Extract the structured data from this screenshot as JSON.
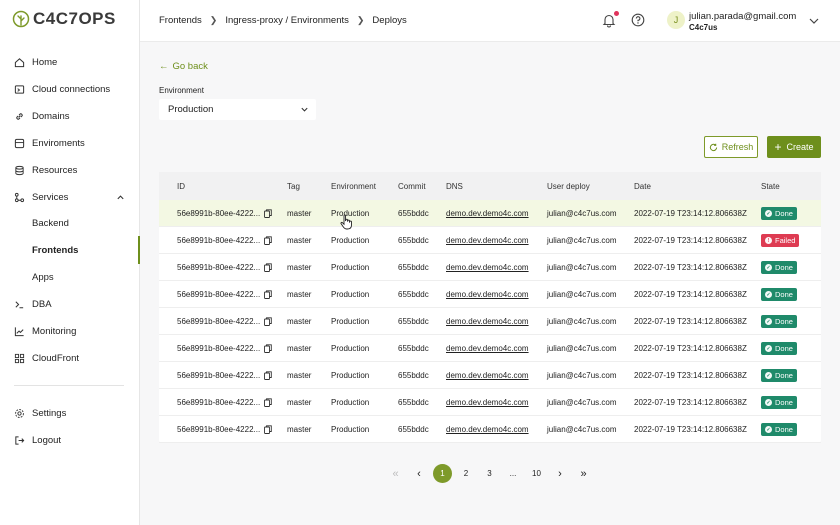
{
  "brand": {
    "logo_text": "C4C7OPS"
  },
  "sidebar": {
    "items": [
      {
        "label": "Home",
        "icon": "home-icon"
      },
      {
        "label": "Cloud connections",
        "icon": "cloud-connections-icon"
      },
      {
        "label": "Domains",
        "icon": "link-icon"
      },
      {
        "label": "Enviroments",
        "icon": "environments-icon"
      },
      {
        "label": "Resources",
        "icon": "database-icon"
      },
      {
        "label": "Services",
        "icon": "services-icon"
      },
      {
        "label": "Backend"
      },
      {
        "label": "Frontends"
      },
      {
        "label": "Apps"
      },
      {
        "label": "DBA",
        "icon": "terminal-icon"
      },
      {
        "label": "Monitoring",
        "icon": "chart-icon"
      },
      {
        "label": "CloudFront",
        "icon": "grid-icon"
      },
      {
        "label": "Settings",
        "icon": "gear-icon"
      },
      {
        "label": "Logout",
        "icon": "logout-icon"
      }
    ]
  },
  "breadcrumb": [
    "Frontends",
    "Ingress-proxy / Environments",
    "Deploys"
  ],
  "user": {
    "initial": "J",
    "email": "julian.parada@gmail.com",
    "org": "C4c7us"
  },
  "back_label": "Go back",
  "environment": {
    "label": "Environment",
    "value": "Production"
  },
  "buttons": {
    "refresh": "Refresh",
    "create": "Create"
  },
  "table": {
    "headers": [
      "ID",
      "Tag",
      "Environment",
      "Commit",
      "DNS",
      "User deploy",
      "Date",
      "State"
    ],
    "rows": [
      {
        "id": "56e8991b-80ee-4222...",
        "tag": "master",
        "env": "Production",
        "commit": "655bddc",
        "dns": "demo.dev.demo4c.com",
        "user": "julian@c4c7us.com",
        "date": "2022-07-19 T23:14:12.806638Z",
        "state": "Done",
        "status": "done"
      },
      {
        "id": "56e8991b-80ee-4222...",
        "tag": "master",
        "env": "Production",
        "commit": "655bddc",
        "dns": "demo.dev.demo4c.com",
        "user": "julian@c4c7us.com",
        "date": "2022-07-19 T23:14:12.806638Z",
        "state": "Failed",
        "status": "failed"
      },
      {
        "id": "56e8991b-80ee-4222...",
        "tag": "master",
        "env": "Production",
        "commit": "655bddc",
        "dns": "demo.dev.demo4c.com",
        "user": "julian@c4c7us.com",
        "date": "2022-07-19 T23:14:12.806638Z",
        "state": "Done",
        "status": "done"
      },
      {
        "id": "56e8991b-80ee-4222...",
        "tag": "master",
        "env": "Production",
        "commit": "655bddc",
        "dns": "demo.dev.demo4c.com",
        "user": "julian@c4c7us.com",
        "date": "2022-07-19 T23:14:12.806638Z",
        "state": "Done",
        "status": "done"
      },
      {
        "id": "56e8991b-80ee-4222...",
        "tag": "master",
        "env": "Production",
        "commit": "655bddc",
        "dns": "demo.dev.demo4c.com",
        "user": "julian@c4c7us.com",
        "date": "2022-07-19 T23:14:12.806638Z",
        "state": "Done",
        "status": "done"
      },
      {
        "id": "56e8991b-80ee-4222...",
        "tag": "master",
        "env": "Production",
        "commit": "655bddc",
        "dns": "demo.dev.demo4c.com",
        "user": "julian@c4c7us.com",
        "date": "2022-07-19 T23:14:12.806638Z",
        "state": "Done",
        "status": "done"
      },
      {
        "id": "56e8991b-80ee-4222...",
        "tag": "master",
        "env": "Production",
        "commit": "655bddc",
        "dns": "demo.dev.demo4c.com",
        "user": "julian@c4c7us.com",
        "date": "2022-07-19 T23:14:12.806638Z",
        "state": "Done",
        "status": "done"
      },
      {
        "id": "56e8991b-80ee-4222...",
        "tag": "master",
        "env": "Production",
        "commit": "655bddc",
        "dns": "demo.dev.demo4c.com",
        "user": "julian@c4c7us.com",
        "date": "2022-07-19 T23:14:12.806638Z",
        "state": "Done",
        "status": "done"
      },
      {
        "id": "56e8991b-80ee-4222...",
        "tag": "master",
        "env": "Production",
        "commit": "655bddc",
        "dns": "demo.dev.demo4c.com",
        "user": "julian@c4c7us.com",
        "date": "2022-07-19 T23:14:12.806638Z",
        "state": "Done",
        "status": "done"
      }
    ]
  },
  "pagination": {
    "current": "1",
    "items": [
      {
        "label": "«",
        "kind": "first"
      },
      {
        "label": "‹",
        "kind": "prev"
      },
      {
        "label": "1",
        "kind": "page"
      },
      {
        "label": "2",
        "kind": "page"
      },
      {
        "label": "3",
        "kind": "page"
      },
      {
        "label": "...",
        "kind": "ellipsis"
      },
      {
        "label": "10",
        "kind": "page"
      },
      {
        "label": "›",
        "kind": "next"
      },
      {
        "label": "»",
        "kind": "last"
      }
    ]
  },
  "colors": {
    "accent": "#6e8f1c",
    "done": "#1f8a6a",
    "failed": "#de3b52",
    "highlight_row": "#f3f8e3"
  }
}
